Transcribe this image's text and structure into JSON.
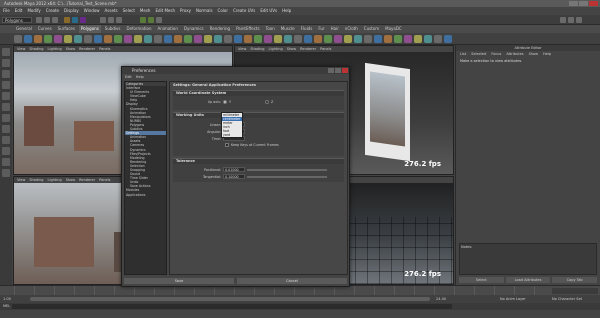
{
  "window": {
    "title": "Autodesk Maya 2012 x64: C:\\...\\Tutorial_Test_Scene.mb*"
  },
  "menubar": [
    "File",
    "Edit",
    "Modify",
    "Create",
    "Display",
    "Window",
    "Assets",
    "Select",
    "Mesh",
    "Edit Mesh",
    "Proxy",
    "Normals",
    "Color",
    "Create UVs",
    "Edit UVs",
    "Help"
  ],
  "statusline": {
    "mode": "Polygons"
  },
  "shelf": {
    "tabs": [
      "General",
      "Curves",
      "Surfaces",
      "Polygons",
      "Subdivs",
      "Deformation",
      "Animation",
      "Dynamics",
      "Rendering",
      "PaintEffects",
      "Toon",
      "Muscle",
      "Fluids",
      "Fur",
      "Hair",
      "nCloth",
      "Custom",
      "MayaDC"
    ],
    "active_tab": "Polygons"
  },
  "viewport_menu": [
    "View",
    "Shading",
    "Lighting",
    "Show",
    "Renderer",
    "Panels"
  ],
  "viewports": {
    "side_fps": "276.2 fps",
    "front_fps": "276.2 fps"
  },
  "attribute_editor": {
    "title": "Attribute Editor",
    "menu": [
      "List",
      "Selected",
      "Focus",
      "Attributes",
      "Show",
      "Help"
    ],
    "message": "Make a selection to view attributes",
    "notes_label": "Notes:",
    "buttons": [
      "Select",
      "Load Attributes",
      "Copy Tab"
    ]
  },
  "range": {
    "start_label": "1.00",
    "end_label": "24.00",
    "anim_layer": "No Anim Layer",
    "char_set": "No Character Set"
  },
  "command_line": {
    "label": "MEL"
  },
  "preferences": {
    "title": "Preferences",
    "menu": [
      "Edit",
      "Help"
    ],
    "categories_header": "Categories",
    "categories": [
      {
        "label": "Interface",
        "sub": false,
        "sel": false
      },
      {
        "label": "UI Elements",
        "sub": true,
        "sel": false
      },
      {
        "label": "ViewCube",
        "sub": true,
        "sel": false
      },
      {
        "label": "Help",
        "sub": true,
        "sel": false
      },
      {
        "label": "Display",
        "sub": false,
        "sel": false
      },
      {
        "label": "Kinematics",
        "sub": true,
        "sel": false
      },
      {
        "label": "Animation",
        "sub": true,
        "sel": false
      },
      {
        "label": "Manipulators",
        "sub": true,
        "sel": false
      },
      {
        "label": "NURBS",
        "sub": true,
        "sel": false
      },
      {
        "label": "Polygons",
        "sub": true,
        "sel": false
      },
      {
        "label": "Subdivs",
        "sub": true,
        "sel": false
      },
      {
        "label": "Settings",
        "sub": false,
        "sel": true
      },
      {
        "label": "Animation",
        "sub": true,
        "sel": false
      },
      {
        "label": "Assets",
        "sub": true,
        "sel": false
      },
      {
        "label": "Cameras",
        "sub": true,
        "sel": false
      },
      {
        "label": "Dynamics",
        "sub": true,
        "sel": false
      },
      {
        "label": "Files/Projects",
        "sub": true,
        "sel": false
      },
      {
        "label": "Modeling",
        "sub": true,
        "sel": false
      },
      {
        "label": "Rendering",
        "sub": true,
        "sel": false
      },
      {
        "label": "Selection",
        "sub": true,
        "sel": false
      },
      {
        "label": "Snapping",
        "sub": true,
        "sel": false
      },
      {
        "label": "Sound",
        "sub": true,
        "sel": false
      },
      {
        "label": "Time Slider",
        "sub": true,
        "sel": false
      },
      {
        "label": "Undo",
        "sub": true,
        "sel": false
      },
      {
        "label": "Save Actions",
        "sub": true,
        "sel": false
      },
      {
        "label": "Modules",
        "sub": false,
        "sel": false
      },
      {
        "label": "Applications",
        "sub": false,
        "sel": false
      }
    ],
    "pane_title": "Settings: General Application Preferences",
    "world_section": "World Coordinate System",
    "up_axis_label": "Up axis:",
    "up_axis_options": [
      "Y",
      "Z"
    ],
    "working_units_section": "Working Units",
    "linear_label": "Linear:",
    "linear_value": "centimeter",
    "angular_label": "Angular:",
    "time_label": "Time:",
    "unit_options": [
      "millimeter",
      "centimeter",
      "meter",
      "inch",
      "foot",
      "yard"
    ],
    "unit_highlight": 1,
    "keep_keys_label": "Keep Keys at Current Frames",
    "tolerance_section": "Tolerance",
    "positional_label": "Positional:",
    "positional_value": "0.01000",
    "tangential_label": "Tangential:",
    "tangential_value": "0.10000",
    "save_button": "Save",
    "cancel_button": "Cancel"
  }
}
